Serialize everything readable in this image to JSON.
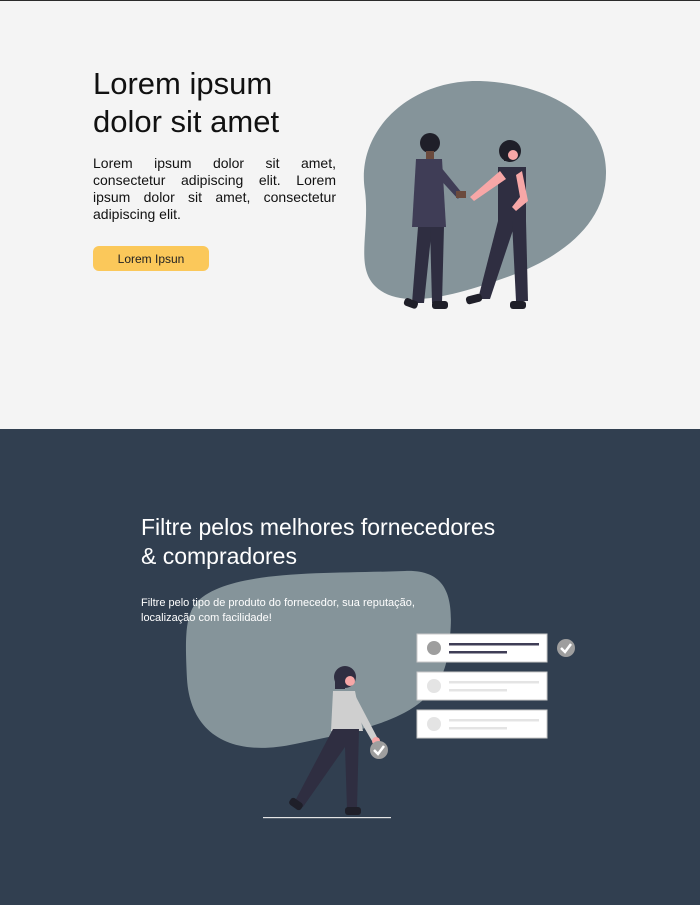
{
  "hero": {
    "title": "Lorem ipsum dolor sit amet",
    "text": "Lorem ipsum dolor sit amet, consectetur adipiscing elit. Lorem ipsum dolor sit amet, consectetur adipiscing elit.",
    "button_label": "Lorem Ipsun",
    "illustration_icon": "handshake-illustration"
  },
  "features": {
    "title": "Filtre pelos melhores fornecedores & compradores",
    "text": "Filtre pelo tipo de produto do fornecedor, sua reputação, localização com facilidade!",
    "illustration_icon": "filter-list-illustration"
  },
  "colors": {
    "hero_bg": "#f4f4f4",
    "features_bg": "#313f50",
    "accent_button": "#fbc85a",
    "blob": "#85949a"
  }
}
